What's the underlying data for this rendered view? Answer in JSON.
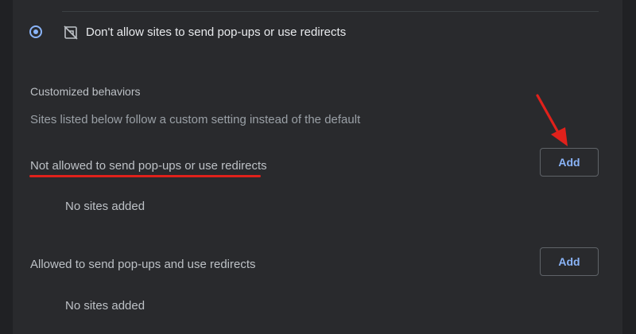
{
  "default_option": {
    "label": "Don't allow sites to send pop-ups or use redirects",
    "icon": "popup-blocked-icon",
    "selected": true
  },
  "customized": {
    "heading": "Customized behaviors",
    "description": "Sites listed below follow a custom setting instead of the default"
  },
  "blocked_list": {
    "label": "Not allowed to send pop-ups or use redirects",
    "add_label": "Add",
    "empty_text": "No sites added"
  },
  "allowed_list": {
    "label": "Allowed to send pop-ups and use redirects",
    "add_label": "Add",
    "empty_text": "No sites added"
  },
  "colors": {
    "accent": "#8ab4f8",
    "annotation": "#e0211b",
    "background": "#292a2d"
  }
}
